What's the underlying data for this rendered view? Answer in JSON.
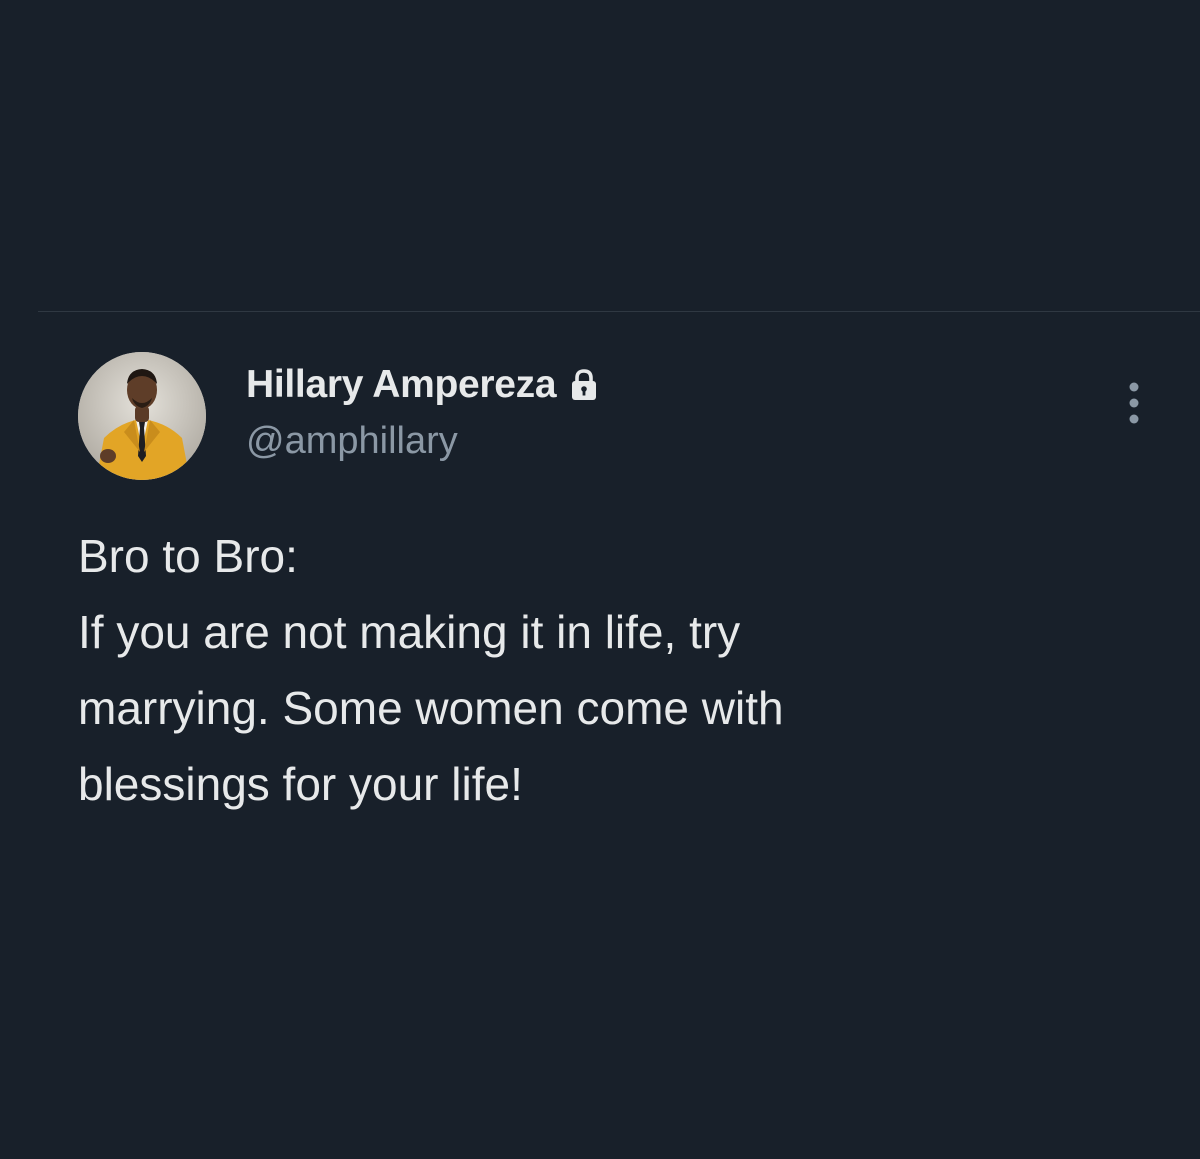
{
  "colors": {
    "background": "#18202a",
    "primary_text": "#e7e9ea",
    "secondary_text": "#8b98a5",
    "divider": "#2f3842"
  },
  "tweet": {
    "author": {
      "display_name": "Hillary Ampereza",
      "handle": "@amphillary",
      "protected_icon": "lock-icon",
      "avatar": "avatar-photo"
    },
    "menu_icon": "more-options-icon",
    "text_lines": [
      "Bro to Bro:",
      "If you are not making it in life, try",
      "marrying. Some women come with",
      "blessings for your life!"
    ]
  }
}
